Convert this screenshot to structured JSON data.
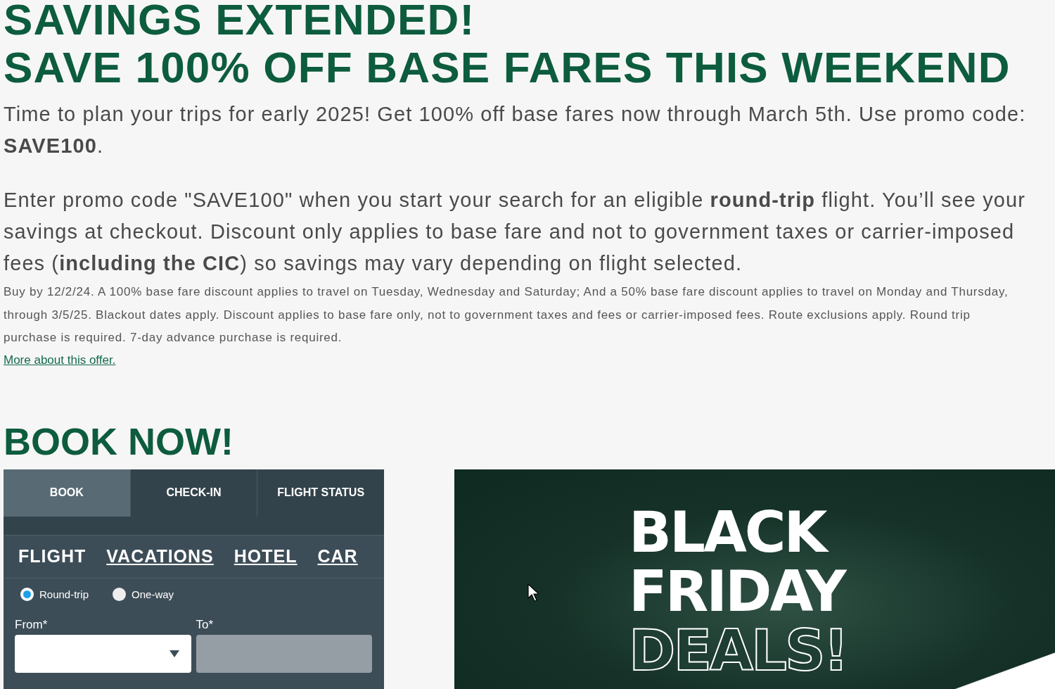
{
  "headline": [
    "SAVINGS EXTENDED!",
    "SAVE 100% OFF BASE FARES THIS WEEKEND"
  ],
  "intro": "Time to plan your trips for early 2025! Get 100% off base fares now through March 5th. Use promo code: **SAVE100**.",
  "details": "Enter promo code \"SAVE100\" when you start your search for an eligible **round-trip** flight. You’ll see your savings at checkout. Discount only applies to base fare and not to government taxes or carrier-imposed fees (**including the CIC**) so savings may vary depending on flight selected.",
  "fine_print": "Buy by 12/2/24. A 100% base fare discount applies to travel on Tuesday, Wednesday and Saturday; And a 50% base fare discount applies to travel on Monday and Thursday, through 3/5/25. Blackout dates apply. Discount applies to base fare only, not to government taxes and fees or carrier-imposed fees.  Route exclusions apply. Round trip purchase is required. 7-day advance purchase is required.",
  "offer_link": "More about this offer.",
  "book_heading": "BOOK NOW!",
  "booking": {
    "tabs": [
      {
        "label": "BOOK",
        "selected": true
      },
      {
        "label": "CHECK-IN",
        "selected": false
      },
      {
        "label": "FLIGHT STATUS",
        "selected": false
      }
    ],
    "products": [
      {
        "label": "FLIGHT",
        "selected": true
      },
      {
        "label": "VACATIONS",
        "selected": false
      },
      {
        "label": "HOTEL",
        "selected": false
      },
      {
        "label": "CAR",
        "selected": false
      }
    ],
    "trip_types": [
      {
        "label": "Round-trip",
        "selected": true
      },
      {
        "label": "One-way",
        "selected": false
      }
    ],
    "fields": [
      {
        "label": "From*",
        "kind": "dropdown",
        "disabled": false
      },
      {
        "label": "To*",
        "kind": "text",
        "disabled": true
      }
    ]
  },
  "banner": {
    "lines": [
      {
        "text": "BLACK",
        "outlined": false
      },
      {
        "text": "FRIDAY",
        "outlined": false
      },
      {
        "text": "DEALS!",
        "outlined": true
      }
    ]
  }
}
